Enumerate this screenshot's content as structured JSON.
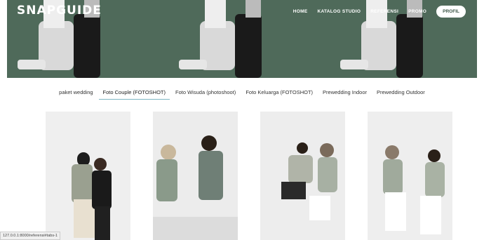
{
  "brand": "SNAPGUIDE",
  "nav": {
    "items": [
      "HOME",
      "KATALOG STUDIO",
      "REFERENSI",
      "PROMO"
    ],
    "profil": "PROFIL"
  },
  "tabs": [
    {
      "label": "paket wedding",
      "active": false
    },
    {
      "label": "Foto Couple (FOTOSHOT)",
      "active": true
    },
    {
      "label": "Foto Wisuda (photoshoot)",
      "active": false
    },
    {
      "label": "Foto Keluarga (FOTOSHOT)",
      "active": false
    },
    {
      "label": "Prewedding Indoor",
      "active": false
    },
    {
      "label": "Prewedding Outdoor",
      "active": false
    }
  ],
  "colors": {
    "hero": "#4f6a5a",
    "tab_underline": "#7fb7c4"
  },
  "status_url": "127.0.0.1:8000/referensi#tabs-1"
}
